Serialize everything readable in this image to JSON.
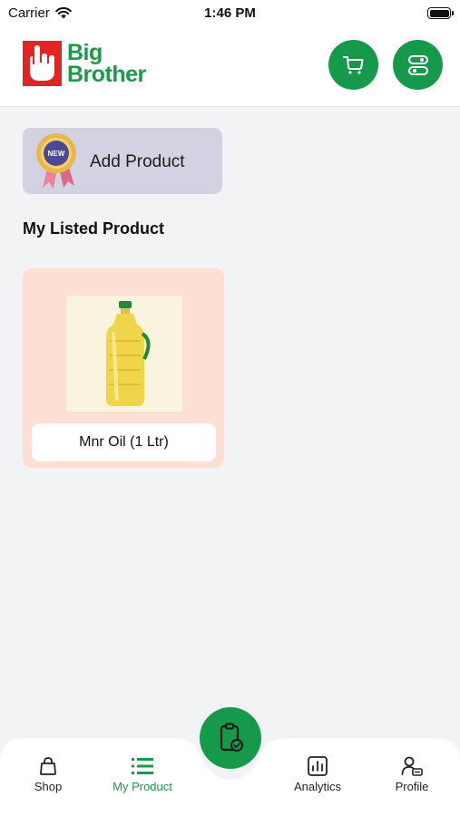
{
  "status_bar": {
    "carrier": "Carrier",
    "time": "1:46 PM"
  },
  "header": {
    "logo_line1": "Big",
    "logo_line2": "Brother",
    "icons": [
      "cart-icon",
      "toggle-icon"
    ]
  },
  "add_product": {
    "label": "Add Product",
    "badge_text": "NEW"
  },
  "section_title": "My Listed Product",
  "products": [
    {
      "name": "Mnr Oil (1 Ltr)"
    }
  ],
  "bottom_nav": {
    "items": [
      {
        "label": "Shop",
        "icon": "bag-icon"
      },
      {
        "label": "My Product",
        "icon": "list-icon",
        "active": true
      },
      {
        "label": "Analytics",
        "icon": "chart-icon"
      },
      {
        "label": "Profile",
        "icon": "profile-icon"
      }
    ],
    "fab_icon": "clipboard-check-icon"
  },
  "colors": {
    "primary": "#17994b",
    "logo_red": "#e32421",
    "card_bg": "#fddfd3",
    "add_bg": "#d3d2e2"
  }
}
